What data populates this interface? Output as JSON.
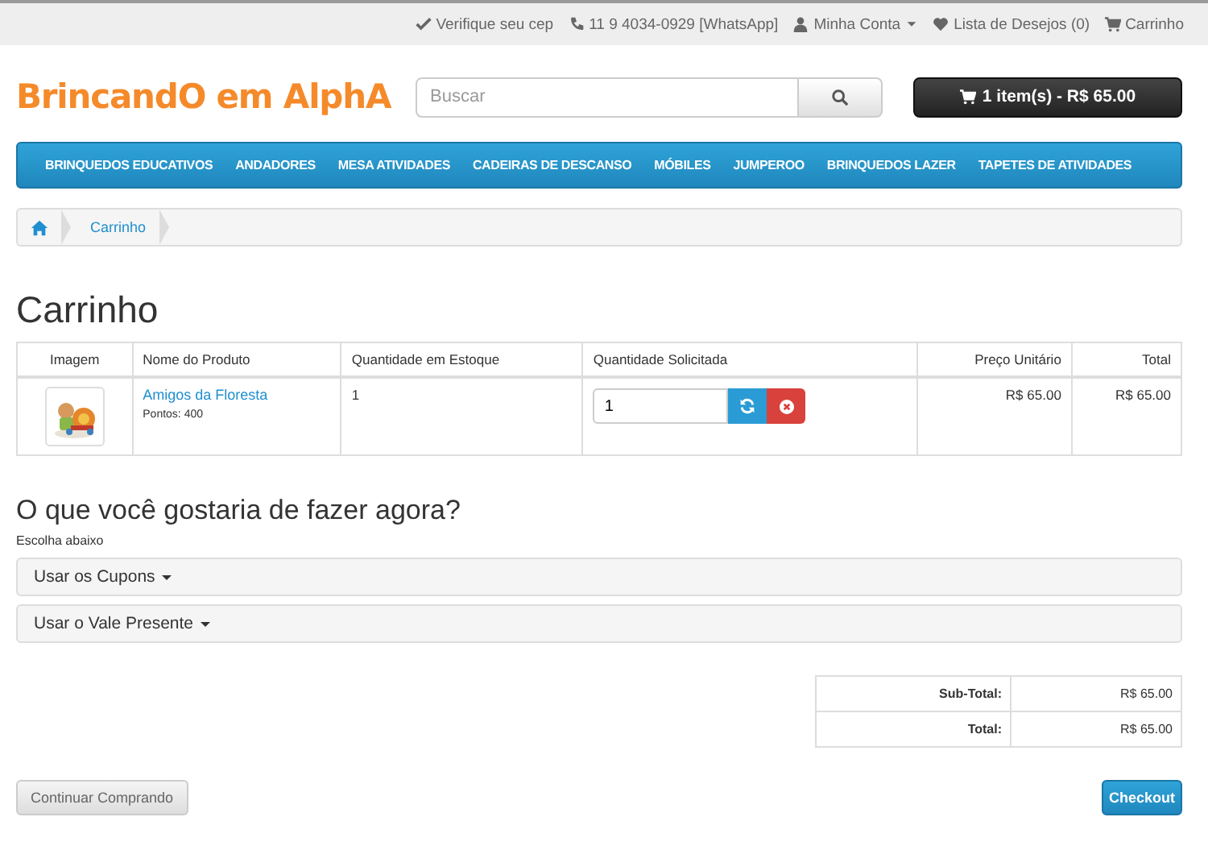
{
  "top_links": [
    {
      "kind": "check",
      "text": "Verifique seu cep",
      "dropdown": false
    },
    {
      "kind": "phone",
      "text": "11 9 4034-0929 [WhatsApp]",
      "dropdown": false
    },
    {
      "kind": "user",
      "text": "Minha Conta",
      "dropdown": true
    },
    {
      "kind": "heart",
      "text": "Lista de Desejos (0)",
      "dropdown": false
    },
    {
      "kind": "cart",
      "text": "Carrinho",
      "dropdown": false
    }
  ],
  "header": {
    "logo": "BrincandO em AlphA",
    "search": {
      "placeholder": "Buscar"
    },
    "cart_button": "1 item(s) - R$ 65.00"
  },
  "nav": [
    "BRINQUEDOS EDUCATIVOS",
    "ANDADORES",
    "MESA ATIVIDADES",
    "CADEIRAS DE DESCANSO",
    "MÓBILES",
    "JUMPEROO",
    "BRINQUEDOS LAZER",
    "TAPETES DE ATIVIDADES"
  ],
  "breadcrumb": [
    {
      "kind": "home"
    },
    {
      "kind": "link",
      "label": "Carrinho"
    }
  ],
  "page_title": "Carrinho",
  "cart_table": {
    "columns": [
      "Imagem",
      "Nome do Produto",
      "Quantidade em Estoque",
      "Quantidade Solicitada",
      "Preço Unitário",
      "Total"
    ],
    "rows": [
      {
        "product": "Amigos da Floresta",
        "points": "Pontos: 400",
        "stock": "1",
        "quantity": "1",
        "unit_price": "R$ 65.00",
        "total": "R$ 65.00"
      }
    ]
  },
  "actions_title": "O que você gostaria de fazer agora?",
  "actions_subtitle": "Escolha abaixo",
  "panels": [
    "Usar os Cupons",
    "Usar o Vale Presente"
  ],
  "totals": [
    {
      "label": "Sub-Total:",
      "value": "R$ 65.00"
    },
    {
      "label": "Total:",
      "value": "R$ 65.00"
    }
  ],
  "buttons": {
    "continue": "Continuar Comprando",
    "checkout": "Checkout"
  }
}
